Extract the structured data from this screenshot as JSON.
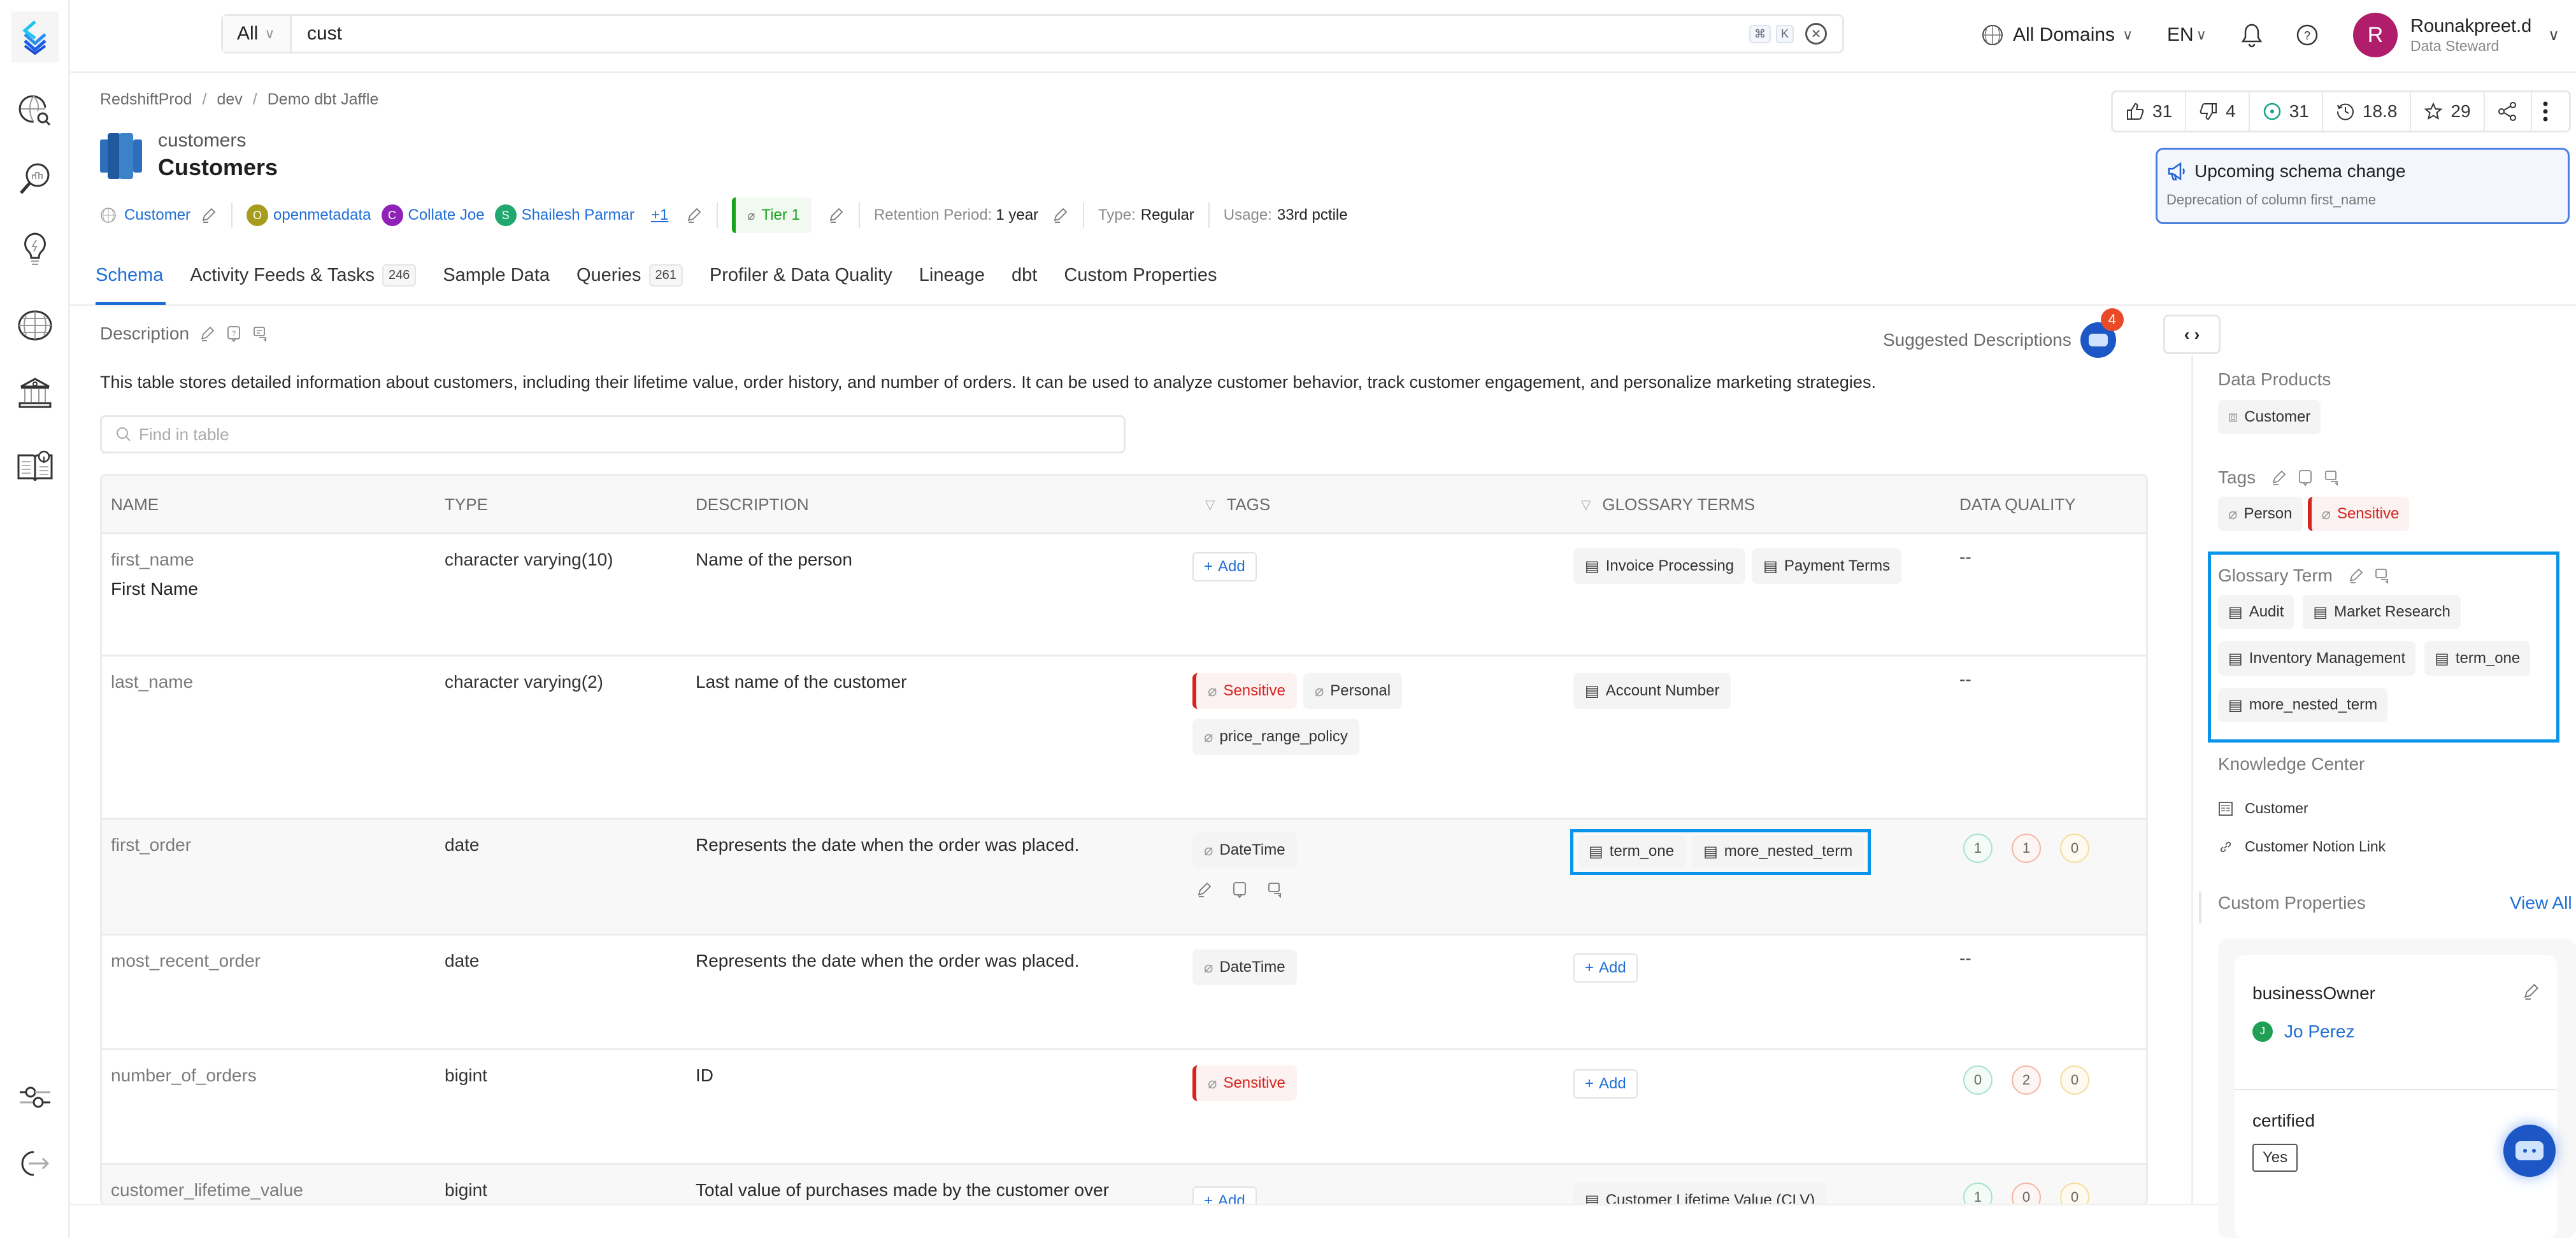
{
  "search": {
    "scope": "All",
    "query": "cust",
    "kbd": [
      "⌘",
      "K"
    ]
  },
  "topbar": {
    "domains": "All Domains",
    "language": "EN",
    "user_initial": "R",
    "user_name": "Rounakpreet.d",
    "user_role": "Data Steward"
  },
  "breadcrumb": [
    "RedshiftProd",
    "dev",
    "Demo dbt Jaffle"
  ],
  "entity": {
    "name": "customers",
    "display_name": "Customers"
  },
  "meta": {
    "domain": "Customer",
    "owners": [
      {
        "initial": "O",
        "name": "openmetadata",
        "color": "#a89c1e"
      },
      {
        "initial": "C",
        "name": "Collate Joe",
        "color": "#9022b8"
      },
      {
        "initial": "S",
        "name": "Shailesh Parmar",
        "color": "#20a86f"
      }
    ],
    "owners_more": "+1",
    "tier": "Tier 1",
    "retention_label": "Retention Period:",
    "retention_value": "1 year",
    "type_label": "Type:",
    "type_value": "Regular",
    "usage_label": "Usage:",
    "usage_value": "33rd pctile"
  },
  "actions": {
    "upvotes": "31",
    "downvotes": "4",
    "followers": "31",
    "version": "18.8",
    "stars": "29"
  },
  "schema_alert": {
    "title": "Upcoming schema change",
    "subtitle": "Deprecation of column first_name"
  },
  "tabs": [
    {
      "label": "Schema",
      "active": true
    },
    {
      "label": "Activity Feeds & Tasks",
      "count": "246"
    },
    {
      "label": "Sample Data"
    },
    {
      "label": "Queries",
      "count": "261"
    },
    {
      "label": "Profiler & Data Quality"
    },
    {
      "label": "Lineage"
    },
    {
      "label": "dbt"
    },
    {
      "label": "Custom Properties"
    }
  ],
  "description": {
    "label": "Description",
    "text": "This table stores detailed information about customers, including their lifetime value, order history, and number of orders. It can be used to analyze customer behavior, track customer engagement, and personalize marketing strategies.",
    "suggested_label": "Suggested Descriptions",
    "suggested_count": "4"
  },
  "find_placeholder": "Find in table",
  "table": {
    "headers": {
      "name": "NAME",
      "type": "TYPE",
      "description": "DESCRIPTION",
      "tags": "TAGS",
      "glossary": "GLOSSARY TERMS",
      "dq": "DATA QUALITY"
    },
    "add_label": "Add",
    "empty": "--",
    "rows": [
      {
        "name": "first_name",
        "display": "First Name",
        "type": "character varying(10)",
        "description": "Name of the person",
        "tags": [],
        "glossary": [
          "Invoice Processing",
          "Payment Terms"
        ],
        "dq": null
      },
      {
        "name": "last_name",
        "type": "character varying(2)",
        "description": "Last name of the customer",
        "tags": [
          {
            "label": "Sensitive",
            "sensitive": true
          },
          {
            "label": "Personal"
          },
          {
            "label": "price_range_policy"
          }
        ],
        "glossary": [
          "Account Number"
        ],
        "dq": null
      },
      {
        "name": "first_order",
        "type": "date",
        "description": "Represents the date when the order was placed.",
        "tags": [
          {
            "label": "DateTime"
          }
        ],
        "glossary": [
          "term_one",
          "more_nested_term"
        ],
        "dq": {
          "success": "1",
          "failed": "1",
          "aborted": "0"
        }
      },
      {
        "name": "most_recent_order",
        "type": "date",
        "description": "Represents the date when the order was placed.",
        "tags": [
          {
            "label": "DateTime"
          }
        ],
        "glossary": [],
        "dq": null
      },
      {
        "name": "number_of_orders",
        "type": "bigint",
        "description": "ID",
        "tags": [
          {
            "label": "Sensitive",
            "sensitive": true
          }
        ],
        "glossary": [],
        "dq": {
          "success": "0",
          "failed": "2",
          "aborted": "0"
        }
      },
      {
        "name": "customer_lifetime_value",
        "type": "bigint",
        "description": "Total value of purchases made by the customer over",
        "tags": [],
        "glossary": [
          "Customer Lifetime Value (CLV)"
        ],
        "dq": {
          "success": "1",
          "failed": "0",
          "aborted": "0"
        }
      }
    ]
  },
  "right_panel": {
    "data_products_label": "Data Products",
    "data_products": [
      "Customer"
    ],
    "tags_label": "Tags",
    "tags": [
      {
        "label": "Person"
      },
      {
        "label": "Sensitive",
        "sensitive": true
      }
    ],
    "glossary_label": "Glossary Term",
    "glossary": [
      "Audit",
      "Market Research",
      "Inventory Management",
      "term_one",
      "more_nested_term"
    ],
    "knowledge_label": "Knowledge Center",
    "knowledge": [
      {
        "label": "Customer",
        "icon": "article-icon"
      },
      {
        "label": "Customer Notion Link",
        "icon": "link-icon"
      }
    ],
    "custom_props_label": "Custom Properties",
    "view_all": "View All",
    "custom_props": [
      {
        "name": "businessOwner",
        "user_initial": "J",
        "user_name": "Jo Perez"
      },
      {
        "name": "certified",
        "value": "Yes"
      }
    ]
  }
}
